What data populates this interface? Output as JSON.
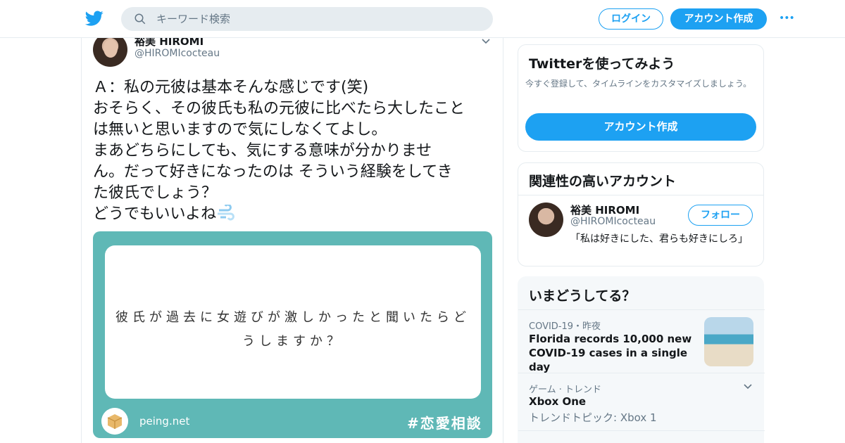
{
  "header": {
    "search_placeholder": "キーワード検索",
    "login_label": "ログイン",
    "signup_label": "アカウント作成",
    "more_label": "•••",
    "brand_color": "#1da1f2"
  },
  "tweet": {
    "author_name": "裕美 HIROMI",
    "author_handle": "@HIROMIcocteau",
    "lines": [
      "Ａ：私の元彼は基本そんな感じです(笑)",
      "おそらく、その彼氏も私の元彼に比べたら大したこと",
      "は無いと思いますので気にしなくてよし。",
      "まあどちらにしても、気にする意味が分かりませ",
      "ん。だって好きになったのは そういう経験をしてき",
      "た彼氏でしょう？",
      "どうでもいいよね"
    ],
    "card": {
      "question_line1": "彼氏が過去に女遊びが激しかったと聞いたらど",
      "question_line2": "うしますか？",
      "site": "peing.net",
      "hashtag": "#恋愛相談"
    }
  },
  "sidebar": {
    "signup_panel": {
      "title": "Twitterを使ってみよう",
      "description": "今すぐ登録して、タイムラインをカスタマイズしましょう。",
      "cta": "アカウント作成"
    },
    "related": {
      "title": "関連性の高いアカウント",
      "name": "裕美 HIROMI",
      "handle": "@HIROMIcocteau",
      "follow_label": "フォロー",
      "bio": "「私は好きにした、君らも好きにしろ」"
    },
    "trends": {
      "title": "いまどうしてる？",
      "items": [
        {
          "meta": "COVID-19・昨夜",
          "headline": "Florida records 10,000 new COVID-19 cases in a single day"
        },
        {
          "meta": "ゲーム · トレンド",
          "topic": "Xbox One",
          "sub": "トレンドトピック: Xbox 1"
        }
      ]
    }
  }
}
